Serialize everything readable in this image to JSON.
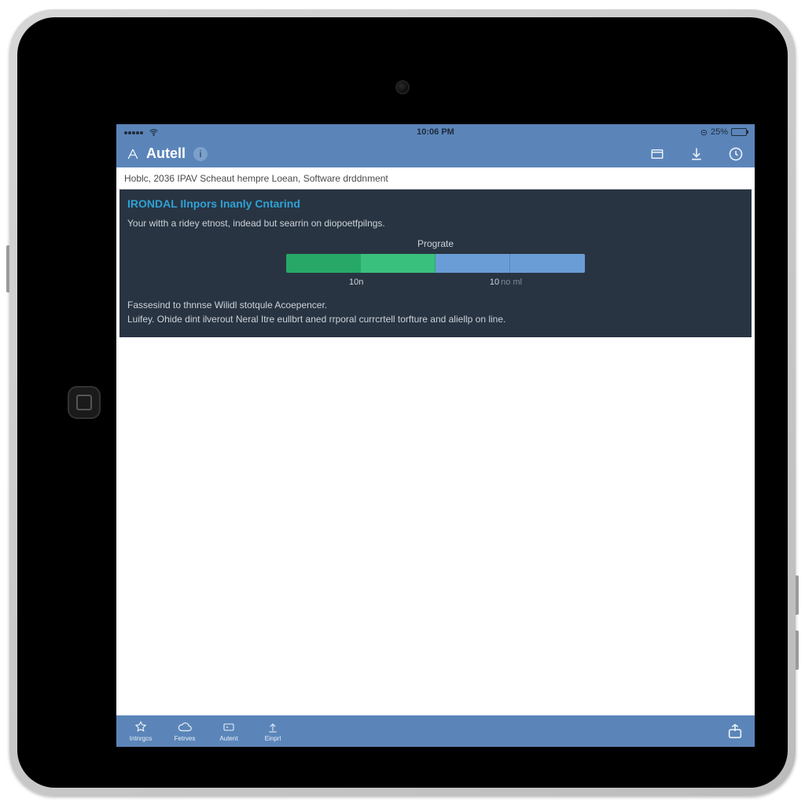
{
  "status": {
    "time": "10:06 PM",
    "battery_text": "25%"
  },
  "header": {
    "brand": "Autell"
  },
  "breadcrumb": {
    "text": "Hoblc, 2036 IPAV Scheaut hempre Loean, Software drddnment"
  },
  "panel": {
    "title": "IRONDAL Ilnpors Inanly Cntarind",
    "subtitle": "Your witth a ridey etnost, indead but searrin on diopoetfpilngs.",
    "progress_label": "Prograte",
    "tick_left": "10n",
    "tick_right": "10",
    "tick_right_sub": "no ml",
    "footer_line1": "Fassesind to thnnse Wilidl stotqule Acoepencer.",
    "footer_line2": "Luifey. Ohide dint ilverout Neral Itre eullbrt aned rrporal currcrtell torfture and aliellp on line."
  },
  "tabs": {
    "items": [
      {
        "label": "Intnrgcs"
      },
      {
        "label": "Fetrves"
      },
      {
        "label": "Autent"
      },
      {
        "label": "Einprl"
      }
    ]
  },
  "colors": {
    "header_bg": "#5b85b9",
    "panel_bg": "#293442",
    "title_blue": "#2ea2d6",
    "green_a": "#27a867",
    "green_b": "#3ac07d",
    "blue_seg": "#6a9dd6"
  }
}
